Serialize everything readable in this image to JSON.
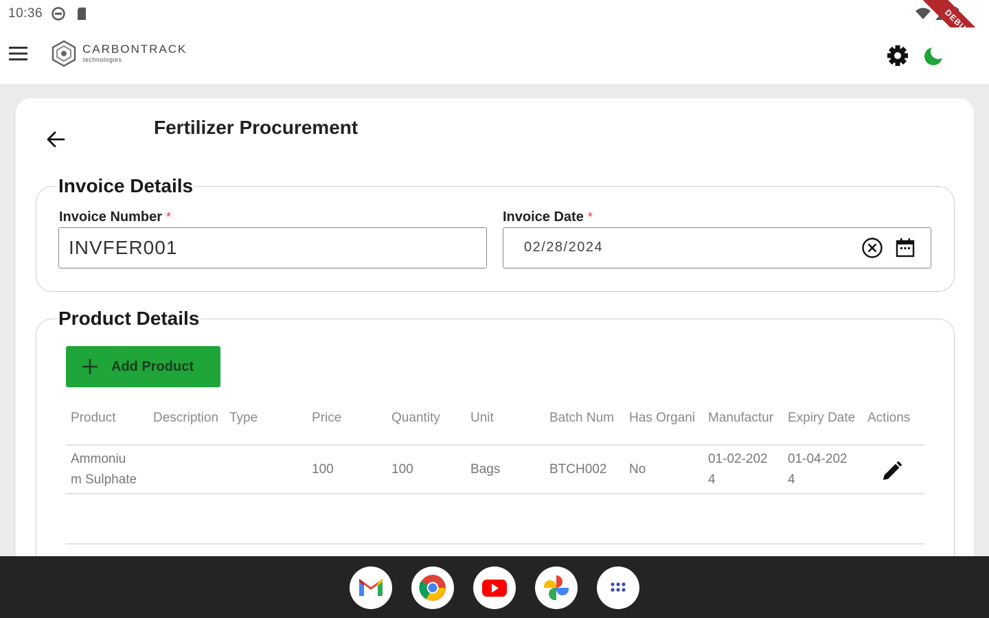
{
  "status_bar": {
    "time": "10:36",
    "debug_banner": "DEBUG"
  },
  "app_bar": {
    "brand_name": "CARBONTRACK",
    "brand_sub": "technologies"
  },
  "page": {
    "title": "Fertilizer Procurement"
  },
  "invoice": {
    "section_title": "Invoice Details",
    "number_label": "Invoice Number",
    "number_value": "INVFER001",
    "date_label": "Invoice Date",
    "date_value": "02/28/2024",
    "required_mark": "*"
  },
  "products": {
    "section_title": "Product Details",
    "add_button_label": "Add Product",
    "columns": [
      "Product",
      "Description",
      "Type",
      "Price",
      "Quantity",
      "Unit",
      "Batch Num",
      "Has Organi",
      "Manufactur",
      "Expiry Date",
      "Actions"
    ],
    "rows": [
      {
        "product_line1": "Ammoniu",
        "product_line2": "m Sulphate",
        "price": "100",
        "quantity": "100",
        "unit": "Bags",
        "batch": "BTCH002",
        "has_organic": "No",
        "manufacture_line1": "01-02-202",
        "manufacture_line2": "4",
        "expiry_line1": "01-04-202",
        "expiry_line2": "4"
      }
    ]
  },
  "colors": {
    "accent_green": "#1fa53a",
    "moon_green": "#1fa53a",
    "required_red": "#e53935",
    "taskbar": "#242424"
  },
  "dock": {
    "apps": [
      "gmail-icon",
      "chrome-icon",
      "youtube-icon",
      "photos-icon",
      "app-launcher-icon"
    ]
  }
}
